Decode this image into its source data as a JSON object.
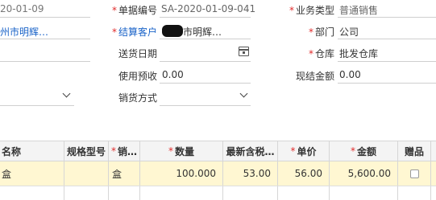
{
  "form": {
    "date_partial": "20-01-09",
    "order_no_label": "单据编号",
    "order_no_value": "SA-2020-01-09-041",
    "biz_type_label": "业务类型",
    "biz_type_value": "普通销售",
    "left_customer_partial": "州市明辉…",
    "customer_label": "结算客户",
    "customer_value": "市明辉…",
    "dept_label": "部门",
    "dept_value": "公司",
    "delivery_date_label": "送货日期",
    "warehouse_label": "仓库",
    "warehouse_value": "批发仓库",
    "prepay_label": "使用预收",
    "prepay_value": "0.00",
    "cash_label": "现结金额",
    "cash_value": "0.00",
    "sales_method_label": "销货方式",
    "required_mark": "*"
  },
  "table": {
    "headers": {
      "name": "名称",
      "spec": "规格型号",
      "unit": "销…",
      "qty": "数量",
      "latest_price": "最新含税…",
      "unit_price": "单价",
      "amount": "金额",
      "gift": "赠品"
    },
    "rows": [
      {
        "name": "盒",
        "spec": "",
        "unit": "盒",
        "qty": "100.000",
        "latest_price": "53.00",
        "unit_price": "56.00",
        "amount": "5,600.00"
      }
    ]
  }
}
